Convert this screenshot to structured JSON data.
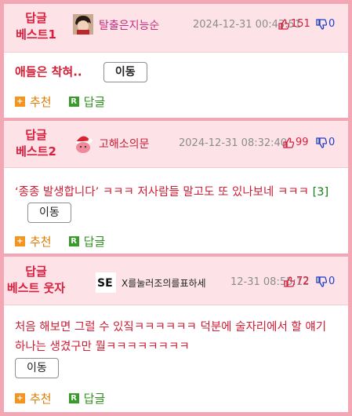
{
  "posts": [
    {
      "rank_line1": "답글",
      "rank_line2": "베스트1",
      "nick": "탈출은지능순",
      "date": "2024-12-31 00:43:51",
      "up": "151",
      "down": "0",
      "content": "애들은 착혀..",
      "extra": "",
      "move": "이동",
      "recommend": "추천",
      "reply": "답글"
    },
    {
      "rank_line1": "답글",
      "rank_line2": "베스트2",
      "nick": "고해소의문",
      "date": "2024-12-31 08:32:40",
      "up": "99",
      "down": "0",
      "content": "‘종종 발생합니다’ ㅋㅋㅋ 저사람들 말고도 또 있나보네 ㅋㅋㅋ",
      "extra": "[3]",
      "move": "이동",
      "recommend": "추천",
      "reply": "답글"
    },
    {
      "rank_line1": "답글",
      "rank_line2": "베스트 웃자",
      "nick": "X를눌러조의를표하세",
      "date": "12-31 08:55:12",
      "up": "72",
      "down": "0",
      "content": "처음 해보면 그럴 수 있짘ㅋㅋㅋㅋㅋㅋ 덕분에 술자리에서 할 얘기 하나는 생겼구만 뭘ㅋㅋㅋㅋㅋㅋㅋㅋ",
      "extra": "",
      "move": "이동",
      "recommend": "추천",
      "reply": "답글"
    }
  ],
  "colors": {
    "accent": "#d81f3e",
    "border": "#f3a6b4",
    "header_bg": "#fde3e7",
    "down": "#1d3fc4",
    "recommend": "#e07a00",
    "reply": "#2f8f1f"
  },
  "icons": {
    "avatar1": "anime-character-avatar",
    "avatar2": "santa-hat-avatar",
    "avatar3": "se-logo-avatar",
    "up": "thumbs-up-icon",
    "down": "thumbs-down-icon",
    "recommend": "plus-square-icon",
    "reply": "r-square-icon"
  }
}
